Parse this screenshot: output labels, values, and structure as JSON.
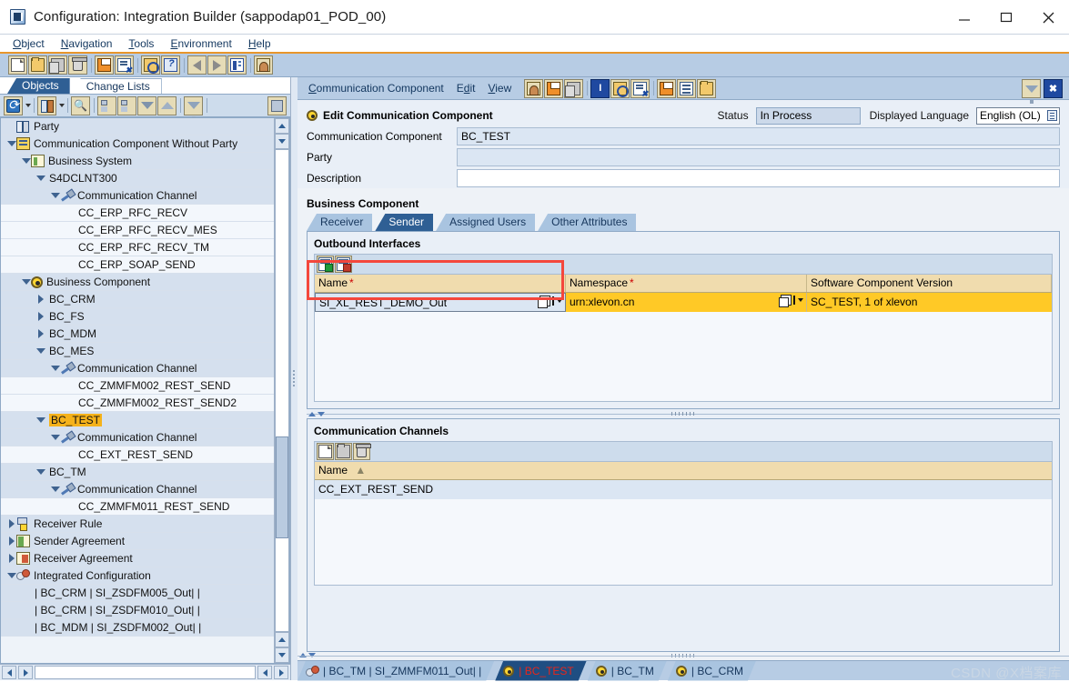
{
  "window": {
    "title": "Configuration: Integration Builder (sappodap01_POD_00)",
    "icon": "app-icon",
    "minimize": "minimize-icon",
    "maximize": "maximize-icon",
    "close": "close-icon"
  },
  "menubar": {
    "items": [
      "Object",
      "Navigation",
      "Tools",
      "Environment",
      "Help"
    ]
  },
  "toolbar": {
    "buttons": [
      {
        "name": "new-icon"
      },
      {
        "name": "open-icon"
      },
      {
        "name": "copy-icon"
      },
      {
        "name": "delete-icon"
      },
      {
        "name": "save-icon"
      },
      {
        "name": "save-all-icon"
      },
      {
        "name": "where-used-icon"
      },
      {
        "name": "help-object-icon"
      },
      {
        "name": "back-icon"
      },
      {
        "name": "forward-icon"
      },
      {
        "name": "list-icon"
      },
      {
        "name": "settings-icon"
      }
    ]
  },
  "left_panel": {
    "tabs": [
      {
        "label": "Objects",
        "active": true
      },
      {
        "label": "Change Lists",
        "active": false
      }
    ],
    "toolbar": [
      {
        "name": "refresh-icon"
      },
      {
        "name": "party-icon"
      },
      {
        "name": "find-icon"
      },
      {
        "name": "expand-all-icon"
      },
      {
        "name": "collapse-all-icon"
      },
      {
        "name": "move-down-icon"
      },
      {
        "name": "move-up-icon"
      },
      {
        "name": "filter-icon"
      },
      {
        "name": "stop-icon"
      }
    ],
    "tree": [
      {
        "label": "Party",
        "depth": 0,
        "twist": "none",
        "icon": "party-icon",
        "band": true
      },
      {
        "label": "Communication Component Without Party",
        "depth": 0,
        "twist": "down",
        "icon": "comm-component-icon",
        "band": true
      },
      {
        "label": "Business System",
        "depth": 1,
        "twist": "down",
        "icon": "business-system-icon",
        "band": true
      },
      {
        "label": "S4DCLNT300",
        "depth": 2,
        "twist": "down",
        "icon": "none",
        "band": true
      },
      {
        "label": "Communication Channel",
        "depth": 3,
        "twist": "down",
        "icon": "channel-icon",
        "band": true
      },
      {
        "label": "CC_ERP_RFC_RECV",
        "depth": 4,
        "twist": "none",
        "icon": "none",
        "band": false
      },
      {
        "label": "CC_ERP_RFC_RECV_MES",
        "depth": 4,
        "twist": "none",
        "icon": "none",
        "band": false
      },
      {
        "label": "CC_ERP_RFC_RECV_TM",
        "depth": 4,
        "twist": "none",
        "icon": "none",
        "band": false
      },
      {
        "label": "CC_ERP_SOAP_SEND",
        "depth": 4,
        "twist": "none",
        "icon": "none",
        "band": false
      },
      {
        "label": "Business Component",
        "depth": 1,
        "twist": "down",
        "icon": "business-component-icon",
        "band": true
      },
      {
        "label": "BC_CRM",
        "depth": 2,
        "twist": "right",
        "icon": "none",
        "band": true
      },
      {
        "label": "BC_FS",
        "depth": 2,
        "twist": "right",
        "icon": "none",
        "band": true
      },
      {
        "label": "BC_MDM",
        "depth": 2,
        "twist": "right",
        "icon": "none",
        "band": true
      },
      {
        "label": "BC_MES",
        "depth": 2,
        "twist": "down",
        "icon": "none",
        "band": true
      },
      {
        "label": "Communication Channel",
        "depth": 3,
        "twist": "down",
        "icon": "channel-icon",
        "band": true
      },
      {
        "label": "CC_ZMMFM002_REST_SEND",
        "depth": 4,
        "twist": "none",
        "icon": "none",
        "band": false
      },
      {
        "label": "CC_ZMMFM002_REST_SEND2",
        "depth": 4,
        "twist": "none",
        "icon": "none",
        "band": false
      },
      {
        "label": "BC_TEST",
        "depth": 2,
        "twist": "down",
        "icon": "none",
        "band": true,
        "highlight": true
      },
      {
        "label": "Communication Channel",
        "depth": 3,
        "twist": "down",
        "icon": "channel-icon",
        "band": true
      },
      {
        "label": "CC_EXT_REST_SEND",
        "depth": 4,
        "twist": "none",
        "icon": "none",
        "band": false
      },
      {
        "label": "BC_TM",
        "depth": 2,
        "twist": "down",
        "icon": "none",
        "band": true
      },
      {
        "label": "Communication Channel",
        "depth": 3,
        "twist": "down",
        "icon": "channel-icon",
        "band": true
      },
      {
        "label": "CC_ZMMFM011_REST_SEND",
        "depth": 4,
        "twist": "none",
        "icon": "none",
        "band": false
      },
      {
        "label": "Receiver Rule",
        "depth": 0,
        "twist": "right",
        "icon": "receiver-rule-icon",
        "band": true
      },
      {
        "label": "Sender Agreement",
        "depth": 0,
        "twist": "right",
        "icon": "sender-agreement-icon",
        "band": true
      },
      {
        "label": "Receiver Agreement",
        "depth": 0,
        "twist": "right",
        "icon": "receiver-agreement-icon",
        "band": true
      },
      {
        "label": "Integrated Configuration",
        "depth": 0,
        "twist": "down",
        "icon": "integrated-config-icon",
        "band": true
      },
      {
        "label": "| BC_CRM | SI_ZSDFM005_Out| |",
        "depth": 1,
        "twist": "none",
        "icon": "none",
        "band": true
      },
      {
        "label": "| BC_CRM | SI_ZSDFM010_Out| |",
        "depth": 1,
        "twist": "none",
        "icon": "none",
        "band": true
      },
      {
        "label": "| BC_MDM | SI_ZSDFM002_Out| |",
        "depth": 1,
        "twist": "none",
        "icon": "none",
        "band": true
      }
    ]
  },
  "right_panel": {
    "menu": [
      "Communication Component",
      "Edit",
      "View"
    ],
    "menu_icons": [
      {
        "name": "edit-mode-icon"
      },
      {
        "name": "save-icon"
      },
      {
        "name": "copy-icon"
      },
      {
        "name": "info-icon"
      },
      {
        "name": "where-used-icon"
      },
      {
        "name": "check-icon"
      },
      {
        "name": "cache-icon"
      },
      {
        "name": "list-icon"
      },
      {
        "name": "history-icon"
      }
    ],
    "menu_right_icons": [
      {
        "name": "pin-icon"
      },
      {
        "name": "close-panel-icon"
      }
    ],
    "header": {
      "title": "Edit Communication Component",
      "status_label": "Status",
      "status_value": "In Process",
      "language_label": "Displayed Language",
      "language_value": "English (OL)"
    },
    "fields": [
      {
        "label": "Communication Component",
        "value": "BC_TEST",
        "readonly": true
      },
      {
        "label": "Party",
        "value": "",
        "readonly": true
      },
      {
        "label": "Description",
        "value": "",
        "readonly": false
      }
    ],
    "section_title": "Business Component",
    "tabs": [
      {
        "label": "Receiver",
        "active": false
      },
      {
        "label": "Sender",
        "active": true
      },
      {
        "label": "Assigned Users",
        "active": false
      },
      {
        "label": "Other Attributes",
        "active": false
      }
    ],
    "outbound": {
      "title": "Outbound Interfaces",
      "toolbar": [
        {
          "name": "insert-row-icon"
        },
        {
          "name": "delete-row-icon"
        }
      ],
      "columns": [
        {
          "label": "Name",
          "required": true
        },
        {
          "label": "Namespace",
          "required": true
        },
        {
          "label": "Software Component Version",
          "required": false
        }
      ],
      "rows": [
        {
          "name": "SI_XL_REST_DEMO_Out",
          "namespace": "urn:xlevon.cn",
          "swcv": "SC_TEST, 1 of xlevon"
        }
      ]
    },
    "channels": {
      "title": "Communication Channels",
      "toolbar": [
        {
          "name": "new-icon"
        },
        {
          "name": "open-icon"
        },
        {
          "name": "delete-icon"
        }
      ],
      "columns": [
        {
          "label": "Name",
          "sort": "ascending"
        }
      ],
      "rows": [
        {
          "name": "CC_EXT_REST_SEND"
        }
      ]
    }
  },
  "dock": {
    "items": [
      {
        "label": "| BC_TM | SI_ZMMFM011_Out| |",
        "icon": "integrated-config-icon",
        "active": false
      },
      {
        "label": "| BC_TEST",
        "icon": "business-component-icon",
        "active": true
      },
      {
        "label": "| BC_TM",
        "icon": "business-component-icon",
        "active": false
      },
      {
        "label": "| BC_CRM",
        "icon": "business-component-icon",
        "active": false
      }
    ],
    "watermark": "CSDN @X档案库"
  },
  "colors": {
    "accent_orange": "#e8962b",
    "tab_active_blue": "#2f5f94",
    "highlight_yellow": "#f5b21a",
    "cell_yellow": "#ffc926",
    "header_tan": "#f0dcae",
    "red_box": "#f4473c"
  }
}
